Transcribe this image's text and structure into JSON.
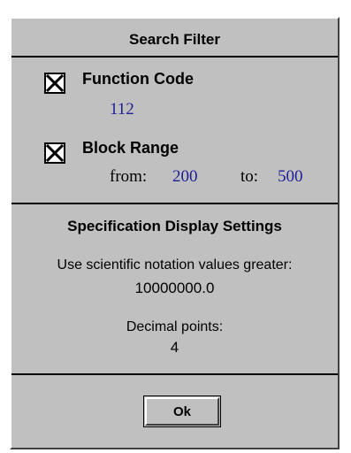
{
  "search_filter": {
    "title": "Search Filter",
    "function_code": {
      "label": "Function Code",
      "checked": true,
      "value": "112"
    },
    "block_range": {
      "label": "Block Range",
      "checked": true,
      "from_label": "from:",
      "from_value": "200",
      "to_label": "to:",
      "to_value": "500"
    }
  },
  "spec_display": {
    "title": "Specification Display Settings",
    "scientific_label": "Use scientific notation values greater:",
    "scientific_value": "10000000.0",
    "decimal_label": "Decimal points:",
    "decimal_value": "4"
  },
  "ok_button": {
    "label": "Ok"
  },
  "colors": {
    "background": "#c0c0c0",
    "value_text": "#1e1e96"
  }
}
